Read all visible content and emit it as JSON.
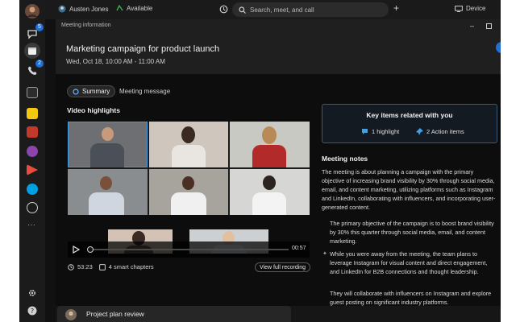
{
  "topbar": {
    "user_name": "Austen Jones",
    "status": "Available",
    "search_placeholder": "Search, meet, and call",
    "device_label": "Device"
  },
  "rail": {
    "chat_badge": "5",
    "calls_badge": "2"
  },
  "meeting": {
    "panel_label": "Meeting information",
    "title": "Marketing campaign for product launch",
    "datetime": "Wed, Oct 18, 10:00 AM - 11:00 AM"
  },
  "tabs": [
    {
      "label": "Summary"
    },
    {
      "label": "Meeting message"
    }
  ],
  "video": {
    "section_title": "Video highlights",
    "duration_end": "00:57",
    "length": "53:23",
    "chapters": "4 smart chapters",
    "view_button": "View full recording"
  },
  "key_items": {
    "title": "Key items related with you",
    "highlights": "1 highlight",
    "actions": "2 Action items"
  },
  "notes": {
    "title": "Meeting notes",
    "intro": "The meeting is about planning a campaign with the primary objective of increasing brand visibility by 30% through social media, email, and content marketing, utilizing platforms such as Instagram and LinkedIn, collaborating with influencers, and incorporating user-generated content.",
    "bullets": [
      "The primary objective of the campaign is to boost brand visibility by 30% this quarter through social media, email, and content marketing.",
      "While you were away from the meeting, the team plans to leverage Instagram for visual content and direct engagement, and LinkedIn for B2B connections and thought leadership.",
      "They will collaborate with influencers on Instagram and explore guest posting on significant industry platforms."
    ]
  },
  "bottom": {
    "project_title": "Project plan review"
  },
  "colors": {
    "accent_blue": "#1f6fd6",
    "key_border": "#3a5a7a",
    "background": "#111111"
  }
}
